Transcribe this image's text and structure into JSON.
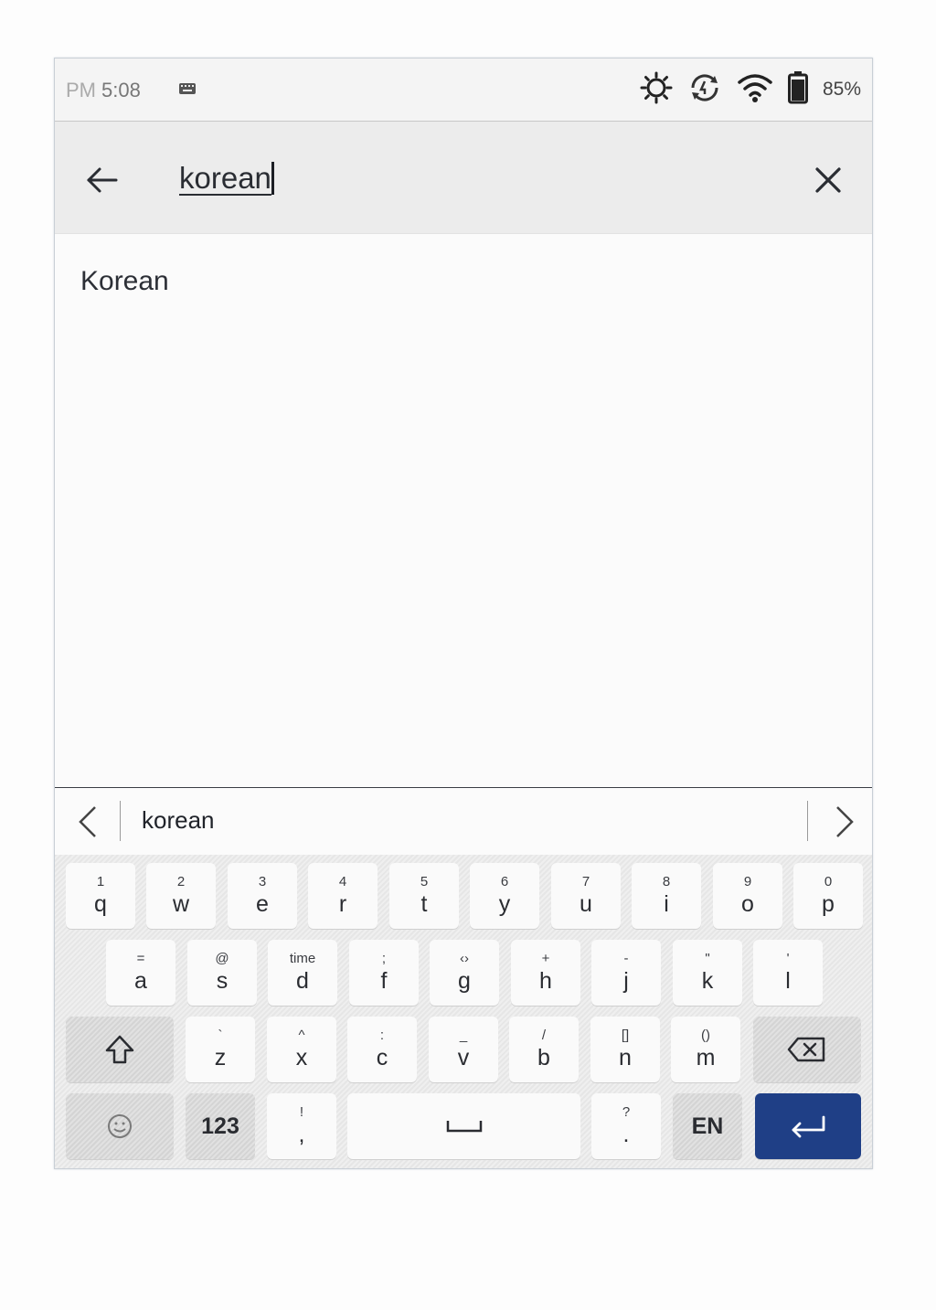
{
  "status_bar": {
    "ampm": "PM",
    "time": "5:08",
    "battery": "85%",
    "icons": [
      "keyboard-icon",
      "brightness-icon",
      "sync-icon",
      "wifi-icon",
      "battery-icon"
    ]
  },
  "search": {
    "query": "korean"
  },
  "results": [
    {
      "label": "Korean"
    }
  ],
  "suggestions": {
    "word": "korean"
  },
  "keyboard": {
    "row1": [
      {
        "hint": "1",
        "main": "q"
      },
      {
        "hint": "2",
        "main": "w"
      },
      {
        "hint": "3",
        "main": "e"
      },
      {
        "hint": "4",
        "main": "r"
      },
      {
        "hint": "5",
        "main": "t"
      },
      {
        "hint": "6",
        "main": "y"
      },
      {
        "hint": "7",
        "main": "u"
      },
      {
        "hint": "8",
        "main": "i"
      },
      {
        "hint": "9",
        "main": "o"
      },
      {
        "hint": "0",
        "main": "p"
      }
    ],
    "row2": [
      {
        "hint": "=",
        "main": "a"
      },
      {
        "hint": "@",
        "main": "s"
      },
      {
        "hint": "time",
        "main": "d"
      },
      {
        "hint": ";",
        "main": "f"
      },
      {
        "hint": "‹›",
        "main": "g"
      },
      {
        "hint": "+",
        "main": "h"
      },
      {
        "hint": "-",
        "main": "j"
      },
      {
        "hint": "\"",
        "main": "k"
      },
      {
        "hint": "'",
        "main": "l"
      }
    ],
    "row3": [
      {
        "hint": "`",
        "main": "z"
      },
      {
        "hint": "^",
        "main": "x"
      },
      {
        "hint": ":",
        "main": "c"
      },
      {
        "hint": "_",
        "main": "v"
      },
      {
        "hint": "/",
        "main": "b"
      },
      {
        "hint": "[]",
        "main": "n"
      },
      {
        "hint": "()",
        "main": "m"
      }
    ],
    "row4": {
      "numbers_label": "123",
      "comma": {
        "hint": "!",
        "main": ","
      },
      "period": {
        "hint": "?",
        "main": "."
      },
      "language_label": "EN"
    }
  }
}
